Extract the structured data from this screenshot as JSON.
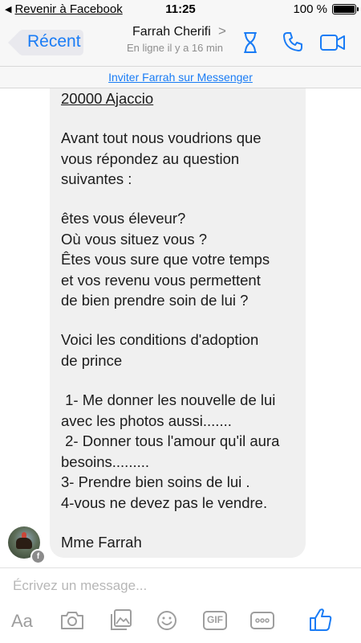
{
  "status_bar": {
    "back_label": "Revenir à Facebook",
    "time": "11:25",
    "battery_percent": "100 %"
  },
  "nav": {
    "back_label": "Récent",
    "contact_name": "Farrah Cherifi",
    "contact_status": "En ligne il y a 16 min",
    "accent_color": "#1a7cf5"
  },
  "invite": {
    "label": "Inviter Farrah sur Messenger"
  },
  "message": {
    "lines": [
      "20000 Ajaccio",
      "Avant tout nous voudrions que",
      "vous répondez au question",
      "suivantes :",
      "êtes vous éleveur?",
      "Où vous situez vous ?",
      "Êtes vous sure que votre temps",
      "et vos revenu vous permettent",
      "de bien prendre soin de lui ?",
      "Voici les conditions d'adoption",
      "de prince",
      " 1- Me donner les nouvelle de lui",
      "avec les photos aussi.......",
      " 2- Donner tous l'amour qu'il aura",
      "besoins.........",
      "3- Prendre bien soins de lui .",
      "4-vous ne devez pas le vendre.",
      "Mme Farrah"
    ]
  },
  "composer": {
    "placeholder": "Écrivez un message...",
    "aa_label": "Aa",
    "gif_label": "GIF",
    "tools": [
      "text-format-icon",
      "camera-icon",
      "gallery-icon",
      "sticker-icon",
      "gif-icon",
      "more-icon",
      "like-icon"
    ]
  }
}
